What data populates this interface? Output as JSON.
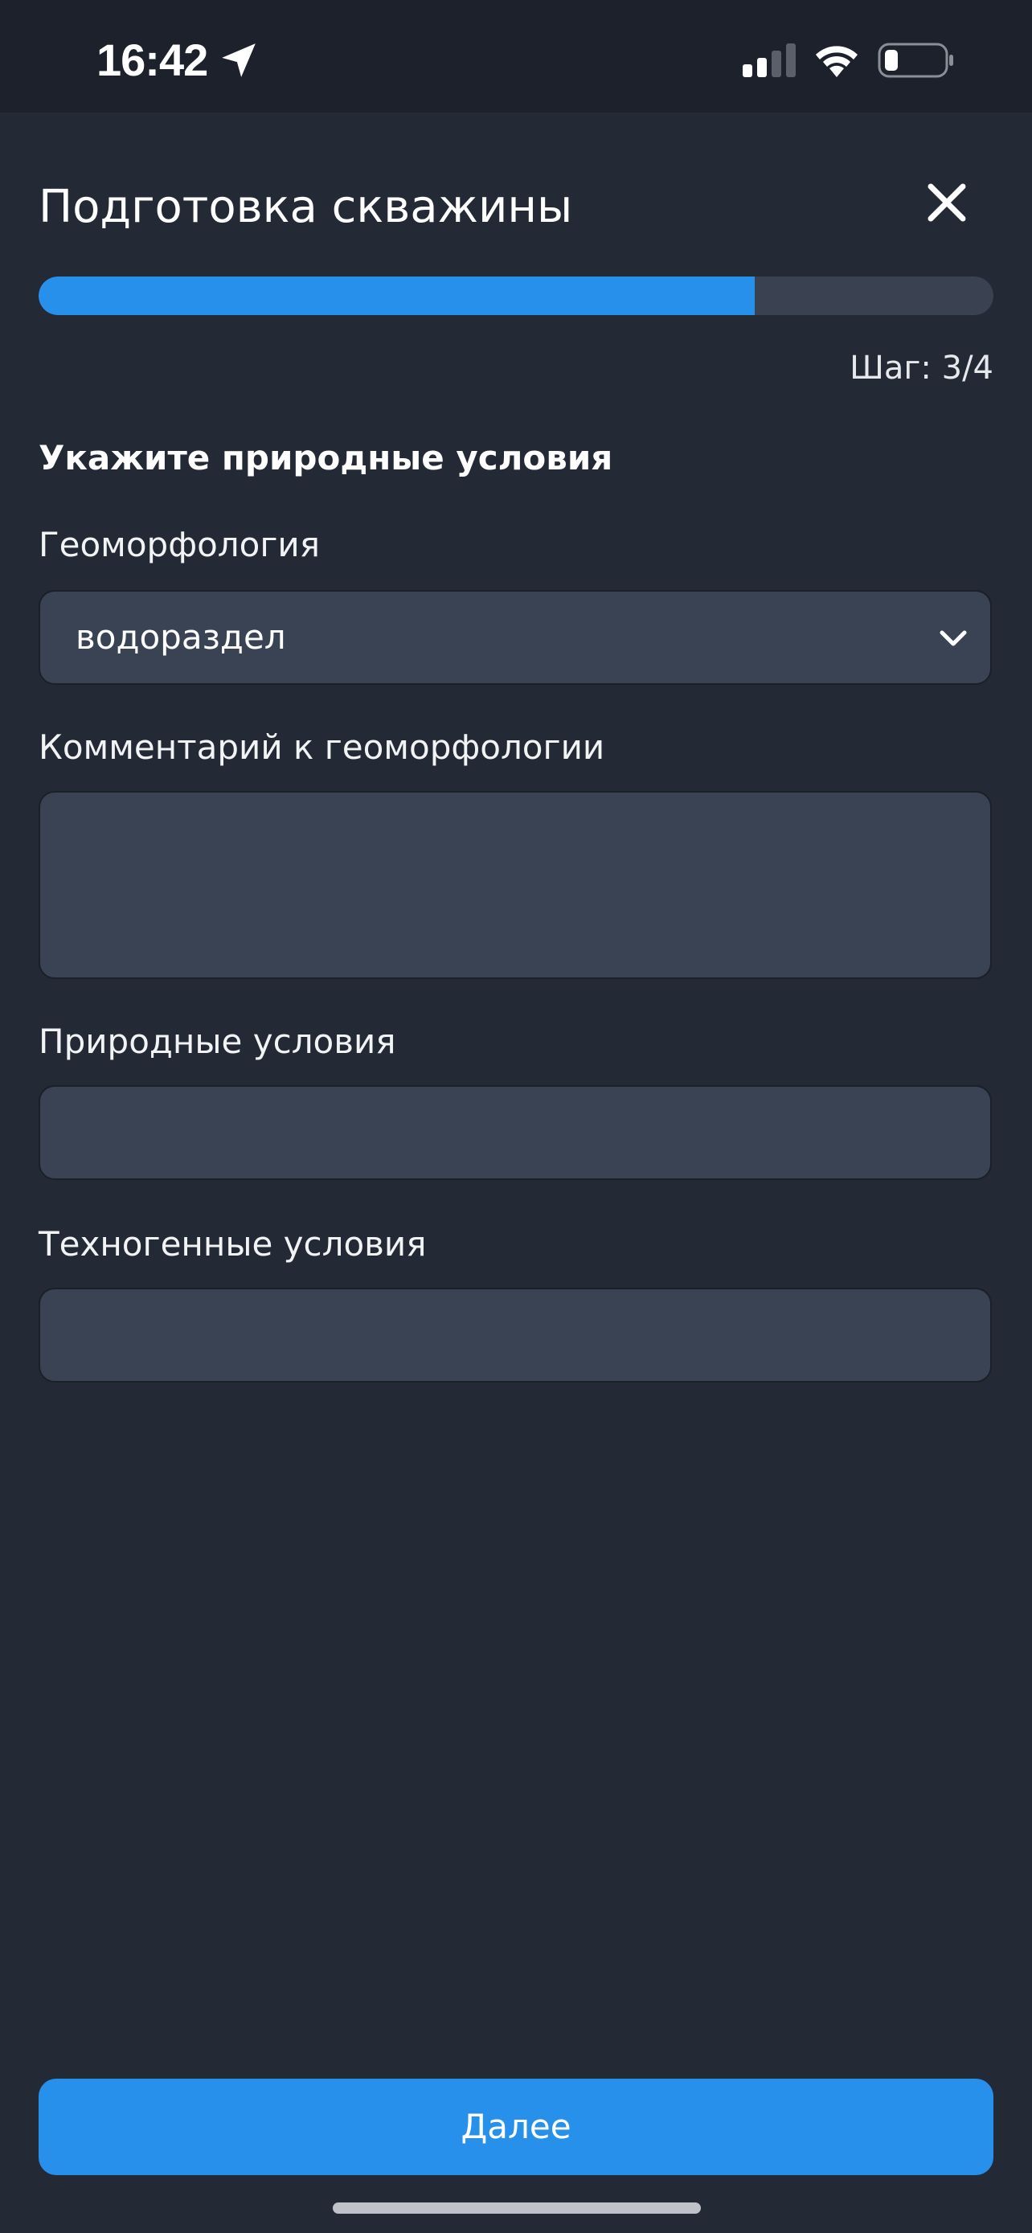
{
  "status_bar": {
    "time": "16:42"
  },
  "header": {
    "title": "Подготовка скважины"
  },
  "progress": {
    "fraction": 0.75,
    "step_label": "Шаг: 3/4"
  },
  "form": {
    "section_heading": "Укажите природные условия",
    "geomorphology": {
      "label": "Геоморфология",
      "value": "водораздел"
    },
    "geomorphology_comment": {
      "label": "Комментарий к геоморфологии",
      "value": ""
    },
    "natural_conditions": {
      "label": "Природные условия",
      "value": ""
    },
    "technogenic_conditions": {
      "label": "Техногенные условия",
      "value": ""
    }
  },
  "footer": {
    "next_label": "Далее"
  },
  "colors": {
    "background": "#242a35",
    "status_bar": "#1d212b",
    "field": "#3a4354",
    "accent": "#2790ea",
    "progress_track": "#3a4252"
  }
}
